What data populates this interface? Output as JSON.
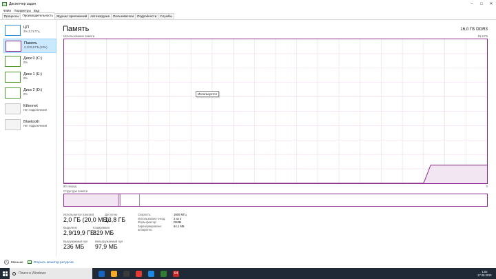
{
  "window": {
    "title": "Диспетчер задач",
    "controls": [
      "–",
      "□",
      "✕"
    ]
  },
  "menu": [
    "Файл",
    "Параметры",
    "Вид"
  ],
  "tabs": [
    {
      "label": "Процессы",
      "active": false
    },
    {
      "label": "Производительность",
      "active": true
    },
    {
      "label": "Журнал приложений",
      "active": false
    },
    {
      "label": "Автозагрузка",
      "active": false
    },
    {
      "label": "Пользователи",
      "active": false
    },
    {
      "label": "Подробности",
      "active": false
    },
    {
      "label": "Службы",
      "active": false
    }
  ],
  "sidebar": {
    "items": [
      {
        "name": "ЦП",
        "sub": "2% 3,71 ГГц",
        "kind": "cpu"
      },
      {
        "name": "Память",
        "sub": "2,1/15,9 ГБ (13%)",
        "kind": "mem",
        "selected": true
      },
      {
        "name": "Диск 0 (C:)",
        "sub": "0%",
        "kind": "disk"
      },
      {
        "name": "Диск 1 (E:)",
        "sub": "0%",
        "kind": "disk"
      },
      {
        "name": "Диск 2 (D:)",
        "sub": "0%",
        "kind": "disk"
      },
      {
        "name": "Ethernet",
        "sub": "Нет подключения",
        "kind": "net"
      },
      {
        "name": "Bluetooth",
        "sub": "Нет подключения",
        "kind": "net"
      }
    ]
  },
  "main": {
    "title": "Память",
    "spec": "16,0 ГБ DDR3",
    "usage_label": "Использование памяти",
    "usage_max": "15,9 ГБ",
    "tooltip": "Используется",
    "axis_left": "60 секунд",
    "axis_right": "0",
    "structure_label": "Структура памяти",
    "stats": {
      "in_use_label": "Используется (сжатая)",
      "in_use_value": "2,0 ГБ (20,0 МБ)",
      "available_label": "Доступно",
      "available_value": "13,8 ГБ",
      "committed_label": "Выделено",
      "committed_value": "2,9/19,9 ГБ",
      "cached_label": "Кэшировано",
      "cached_value": "829 МБ",
      "paged_label": "Выгружаемый пул",
      "paged_value": "236 МБ",
      "nonpaged_label": "Невыгружаемый пул",
      "nonpaged_value": "97,9 МБ"
    },
    "specs": [
      {
        "k": "Скорость:",
        "v": "1600 МГц"
      },
      {
        "k": "Использовано гнезд:",
        "v": "2 из 4"
      },
      {
        "k": "Форм-фактор:",
        "v": "DIMM"
      },
      {
        "k": "Зарезервировано аппаратно:",
        "v": "64,1 МБ"
      }
    ]
  },
  "chart_data": {
    "type": "area",
    "x_range_seconds": [
      60,
      0
    ],
    "y_range_gb": [
      0,
      15.9
    ],
    "series": [
      {
        "values_gb": [
          0,
          0,
          0,
          0,
          0,
          0,
          0,
          0,
          0,
          0,
          0,
          0,
          0,
          0,
          0,
          0,
          0,
          0,
          0,
          0,
          0,
          0,
          0,
          0,
          0,
          0,
          0,
          0,
          0,
          0,
          0,
          0,
          0,
          0,
          0,
          0,
          0,
          0,
          0,
          0,
          0,
          0,
          0,
          0,
          0,
          0,
          0,
          0,
          0,
          0,
          0,
          0,
          2.0,
          2.0,
          2.0,
          2.0,
          2.0,
          2.0,
          2.0,
          2.0,
          2.0
        ]
      }
    ],
    "grid": true
  },
  "footer": {
    "less_details": "Меньше",
    "open_monitor": "Открыть монитор ресурсов"
  },
  "taskbar": {
    "search_placeholder": "Поиск в Windows",
    "time": "1:02",
    "date": "17.06.2021",
    "icon_colors": [
      "#1565c0",
      "#f9a825",
      "#3a3a3a",
      "#e53935",
      "#1e88e5",
      "#2e7d32",
      "#c62828"
    ],
    "badge": "64"
  },
  "colors": {
    "memory_accent": "#8b2a8b",
    "memory_fill": "#f3e6f3",
    "cpu_accent": "#2a8ed9",
    "disk_accent": "#4c9a2a"
  }
}
